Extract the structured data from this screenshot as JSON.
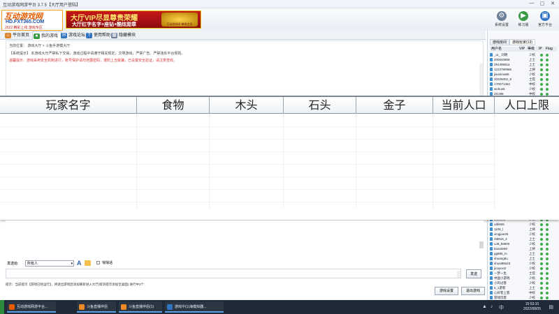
{
  "window": {
    "title": "互动游戏网游平台 3.7.5【大厅用户登陆】",
    "minimize": "—",
    "maximize": "▢",
    "close": "✕"
  },
  "logo": {
    "line1": "互动游戏网",
    "line2": "HD.FXT365.COM",
    "line3": "2022 精彩上线 游戏专区"
  },
  "banner": {
    "headline": "大厅VIP尽显尊贵荣耀",
    "sub": "大厅红字名字+座钻+酷炫勋章",
    "badge": "互动游戏网 尊贵会员"
  },
  "toolbar": {
    "items": [
      {
        "label": "系统设置",
        "icon": "gear-icon",
        "color": "#6b7f99"
      },
      {
        "label": "练习版",
        "icon": "game-icon",
        "color": "#3a9b47"
      },
      {
        "label": "官方平台",
        "icon": "screen-icon",
        "color": "#2f74c0"
      }
    ]
  },
  "nav": {
    "tabs": [
      {
        "label": "平台首页",
        "icon": "home-icon",
        "color": "#d9822b"
      },
      {
        "label": "我的游戏",
        "icon": "game-icon",
        "color": "#3a9b47"
      },
      {
        "label": "游戏论坛",
        "icon": "forum-icon",
        "color": "#2f74c0"
      },
      {
        "label": "使用帮助",
        "icon": "help-icon",
        "color": "#2f74c0"
      },
      {
        "label": "隐藏模块",
        "icon": "module-icon",
        "color": "#6b7f99"
      }
    ]
  },
  "chat": {
    "lines": [
      {
        "text": "当前位置：   游戏大厅  >  斗鱼手游模大厅",
        "color": "#444"
      },
      {
        "text": "【系统提示】 本游戏大厅严禁私下交易，游戏过程中请遵守相关规定，文明游戏，严禁广告、严禁违反平台规则。",
        "color": "#444"
      },
      {
        "text": "温馨提示：游戏采用安全机制进行，账号保护请勿泄露密码，谨防上当受骗，已设置安全验证，请注意查收。",
        "color": "#d63a3a"
      }
    ]
  },
  "right_panel": {
    "tabs": [
      "游戏房间",
      "游戏玩家(13)"
    ],
    "header": {
      "name": "用户名",
      "level": "VIP",
      "status": "等级",
      "col": "IP",
      "extra": "Flag"
    },
    "users_top": [
      {
        "name": "_ur_ 刘明",
        "level": "少校"
      },
      {
        "name": "200040956",
        "level": "上士"
      },
      {
        "name": "29149561a",
        "level": "上士"
      },
      {
        "name": "1213790966",
        "level": "上将"
      },
      {
        "name": "jiaosima66",
        "level": "少校"
      },
      {
        "name": "20225002_9",
        "level": "士官"
      },
      {
        "name": "A70071362",
        "level": "中校"
      },
      {
        "name": "wuhus6",
        "level": "少校"
      },
      {
        "name": "ZGJ88",
        "level": "中校"
      },
      {
        "name": "2009099582",
        "level": "少校"
      },
      {
        "name": "xinstz26",
        "level": "少校"
      },
      {
        "name": "yj82226",
        "level": "士官"
      }
    ],
    "users_bottom": [
      {
        "name": "bf08008",
        "level": "少将"
      },
      {
        "name": "u8k926",
        "level": "少校"
      },
      {
        "name": "1108_l",
        "level": "上将"
      },
      {
        "name": "xingjiae26",
        "level": "少校"
      },
      {
        "name": "4t8916_2",
        "level": "上士"
      },
      {
        "name": "uJ8_b8800",
        "level": "少校"
      },
      {
        "name": "tianxile90",
        "level": "上将"
      },
      {
        "name": "gg885_m",
        "level": "上士"
      },
      {
        "name": "shuang8u",
        "level": "上士"
      },
      {
        "name": "shuai88a23",
        "level": "少校"
      },
      {
        "name": "jicayuxi2",
        "level": "少校"
      },
      {
        "name": "一梦一生",
        "level": "士官"
      },
      {
        "name": "中国小游戏",
        "level": "少校"
      },
      {
        "name": "小鸡过客",
        "level": "少校"
      },
      {
        "name": "5_1游客",
        "level": "上士"
      },
      {
        "name": "心好客上客",
        "level": "中校"
      },
      {
        "name": "游戏玩客",
        "level": "少校"
      },
      {
        "name": "hao8_1",
        "level": "上士"
      }
    ]
  },
  "table": {
    "columns": [
      "玩家名字",
      "食物",
      "木头",
      "石头",
      "金子",
      "当前人口",
      "人口上限"
    ],
    "rows": [],
    "marker": "1"
  },
  "input": {
    "target_label": "发送给:",
    "target_value": "所有人",
    "font_label": "A",
    "checkbox_label": "悄悄话",
    "message_value": "",
    "send_label": "发送"
  },
  "status": {
    "text": "提示：当前提示【游戏已经运行】，将退出游戏后添加重新进入大厅(取消提示添加至桌面)    进行中3个"
  },
  "bottom_buttons": {
    "left": "游戏设置",
    "right": "退出游戏"
  },
  "taskbar": {
    "tasks": [
      {
        "label": "互动游戏网游平台...",
        "color": "#e55c00"
      },
      {
        "label": "斗鱼直播伴侣",
        "color": "#f08a24"
      },
      {
        "label": "斗鱼直播伴侣(1)",
        "color": "#f08a24"
      },
      {
        "label": "游戏中(1)海模拟器...",
        "color": "#2f74c0"
      }
    ],
    "time": "15:53:10",
    "date": "2022/08/05"
  }
}
